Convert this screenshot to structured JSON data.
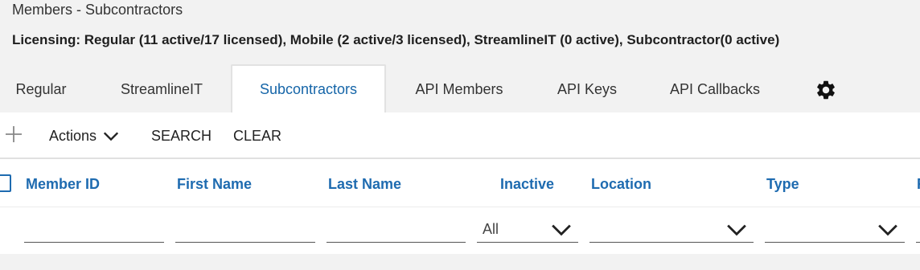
{
  "page": {
    "title": "Members - Subcontractors",
    "licensing": "Licensing: Regular (11 active/17 licensed), Mobile (2 active/3 licensed), StreamlineIT (0 active), Subcontractor(0 active)"
  },
  "tabs": [
    {
      "label": "Regular"
    },
    {
      "label": "StreamlineIT"
    },
    {
      "label": "Subcontractors",
      "active": true
    },
    {
      "label": "API Members"
    },
    {
      "label": "API Keys"
    },
    {
      "label": "API Callbacks"
    }
  ],
  "tabs_settings_icon": "gear-icon",
  "toolbar": {
    "add_icon": "plus-icon",
    "actions_label": "Actions",
    "search_label": "SEARCH",
    "clear_label": "CLEAR"
  },
  "table": {
    "columns": [
      "Member ID",
      "First Name",
      "Last Name",
      "Inactive",
      "Location",
      "Type",
      "R"
    ],
    "filters": {
      "inactive_selected": "All",
      "location_selected": "",
      "type_selected": ""
    }
  },
  "colors": {
    "accent": "#1e6bb0",
    "background": "#f2f2f2",
    "panel": "#ffffff"
  }
}
